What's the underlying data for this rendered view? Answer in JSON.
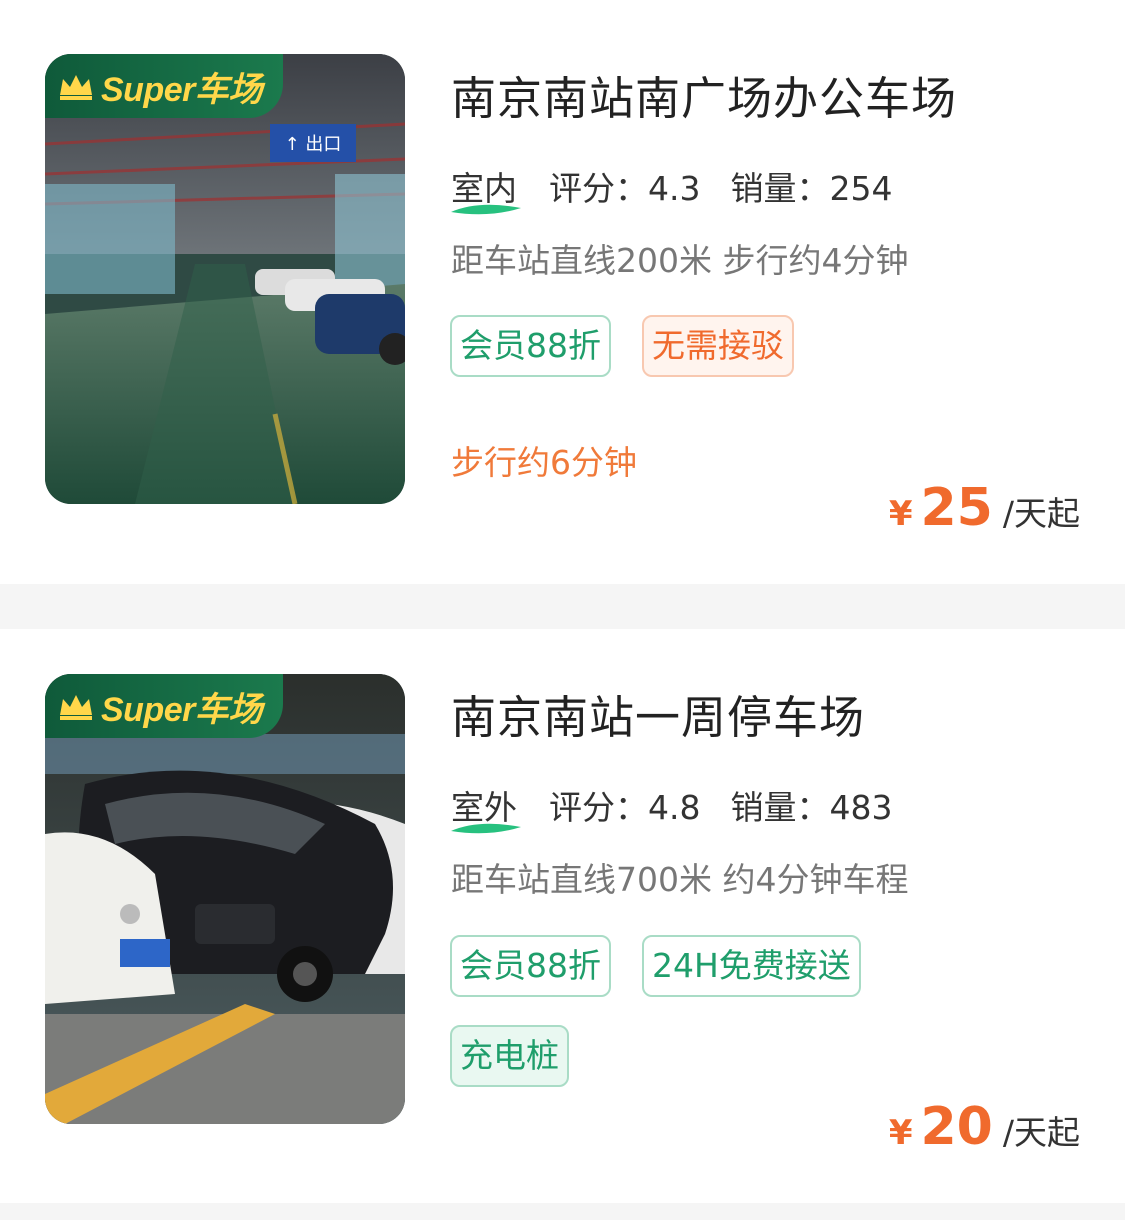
{
  "badge": {
    "label": "Super车场"
  },
  "lots": [
    {
      "name": "南京南站南广场办公车场",
      "type": "室内",
      "rating": "评分：4.3",
      "sales": "销量：254",
      "distance": "距车站直线200米 步行约4分钟",
      "tags": [
        "会员88折",
        "无需接驳"
      ],
      "walk_note": "步行约6分钟",
      "price_symbol": "¥",
      "price": "25",
      "price_unit": "/天起"
    },
    {
      "name": "南京南站一周停车场",
      "type": "室外",
      "rating": "评分：4.8",
      "sales": "销量：483",
      "distance": "距车站直线700米 约4分钟车程",
      "tags": [
        "会员88折",
        "24H免费接送",
        "充电桩"
      ],
      "price_symbol": "¥",
      "price": "20",
      "price_unit": "/天起"
    }
  ],
  "colors": {
    "accent_orange": "#f06a2d",
    "tag_green": "#1f9e6b",
    "badge_green": "#0f5a3a",
    "badge_text": "#ffd74a"
  }
}
